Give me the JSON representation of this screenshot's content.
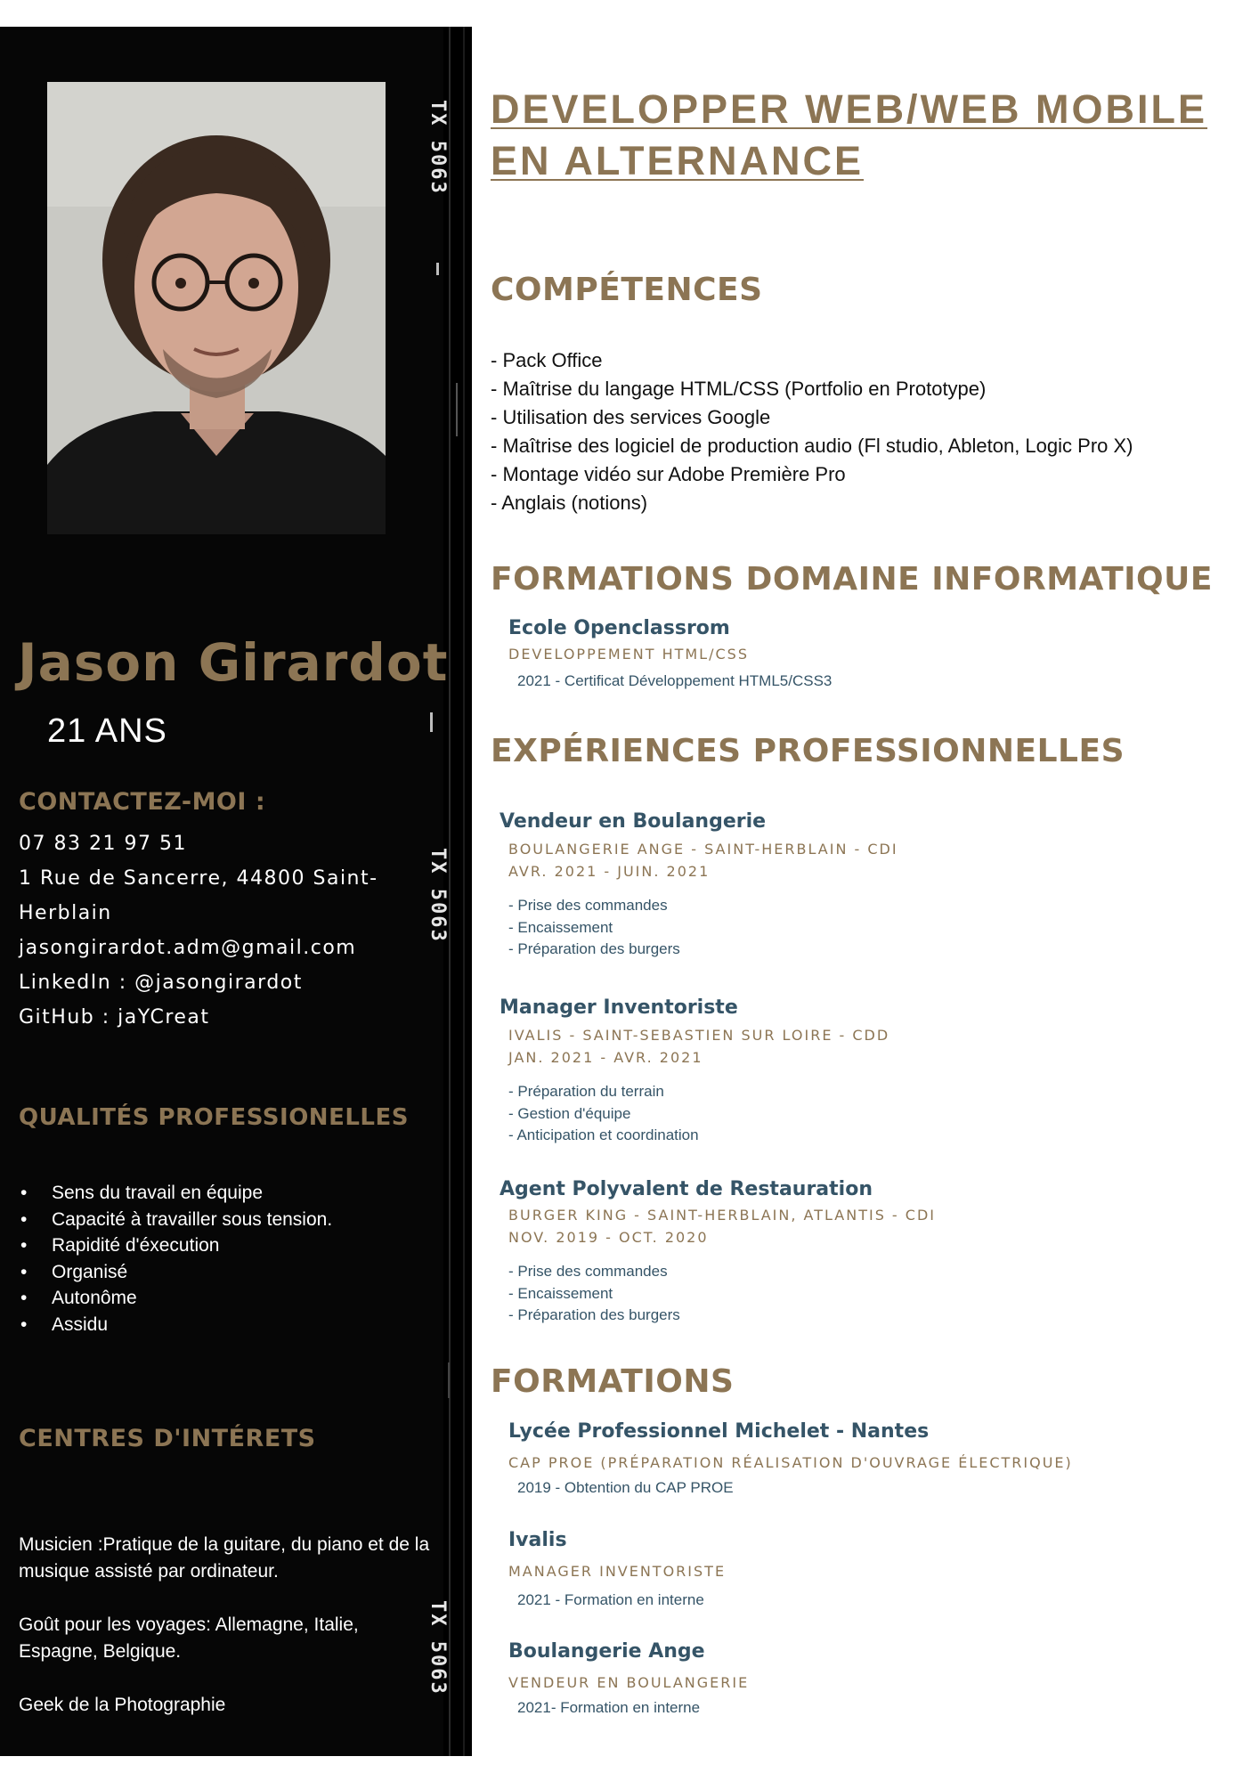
{
  "profile": {
    "name": "Jason Girardot",
    "age": "21 ANS",
    "photo_alt": "portrait-photo",
    "film_marks": [
      "TX 5063",
      "TX 5063",
      "TX 5063"
    ]
  },
  "contact": {
    "heading": "CONTACTEZ-MOI :",
    "phone": "07 83 21 97 51",
    "address_line1": "1 Rue de Sancerre, 44800 Saint-",
    "address_line2": "Herblain",
    "email": "jasongirardot.adm@gmail.com",
    "linkedin": "LinkedIn : @jasongirardot",
    "github": "GitHub : jaYCreat"
  },
  "qualities": {
    "heading": "QUALITÉS PROFESSIONELLES",
    "items": [
      "Sens du travail en équipe",
      "Capacité à travailler sous tension.",
      "Rapidité d'éxecution",
      "Organisé",
      "Autonôme",
      "Assidu"
    ]
  },
  "interests": {
    "heading": "CENTRES D'INTÉRETS",
    "paragraphs": [
      "Musicien :Pratique de la guitare, du piano et de la musique assisté par ordinateur.",
      "Goût pour les voyages: Allemagne, Italie, Espagne, Belgique.",
      "Geek de la Photographie"
    ]
  },
  "header": {
    "title_line1": "DEVELOPPER WEB/WEB MOBILE",
    "title_line2": "EN ALTERNANCE"
  },
  "skills": {
    "heading": "COMPÉTENCES",
    "items": [
      "- Pack Office",
      "- Maîtrise du langage HTML/CSS (Portfolio en Prototype)",
      "- Utilisation des services Google",
      "- Maîtrise des logiciel de production audio (Fl studio, Ableton, Logic Pro X)",
      "- Montage vidéo sur Adobe Première Pro",
      "- Anglais (notions)"
    ]
  },
  "it_training": {
    "heading": "FORMATIONS DOMAINE INFORMATIQUE",
    "school": "Ecole Openclassrom",
    "program": "DEVELOPPEMENT HTML/CSS",
    "note": "2021 - Certificat Développement HTML5/CSS3"
  },
  "experience": {
    "heading": "EXPÉRIENCES PROFESSIONNELLES",
    "jobs": [
      {
        "title": "Vendeur en Boulangerie",
        "company": "BOULANGERIE ANGE - SAINT-HERBLAIN - CDI",
        "dates": "AVR. 2021 - JUIN. 2021",
        "tasks": [
          "- Prise des commandes",
          "- Encaissement",
          "- Préparation des burgers"
        ]
      },
      {
        "title": "Manager Inventoriste",
        "company": "IVALIS - SAINT-SEBASTIEN SUR LOIRE - CDD",
        "dates": "JAN. 2021 - AVR. 2021",
        "tasks": [
          "- Préparation du terrain",
          "- Gestion d'équipe",
          "- Anticipation et coordination"
        ]
      },
      {
        "title": "Agent Polyvalent de Restauration",
        "company": "BURGER KING - SAINT-HERBLAIN, ATLANTIS - CDI",
        "dates": "NOV. 2019 - OCT. 2020",
        "tasks": [
          "- Prise des commandes",
          "- Encaissement",
          "- Préparation des burgers"
        ]
      }
    ]
  },
  "education": {
    "heading": "FORMATIONS",
    "items": [
      {
        "school": "Lycée Professionnel Michelet - Nantes",
        "program": "CAP PROE (PRÉPARATION RÉALISATION D'OUVRAGE ÉLECTRIQUE)",
        "note": "2019 - Obtention du CAP PROE"
      },
      {
        "school": "Ivalis",
        "program": "MANAGER INVENTORISTE",
        "note": "2021 - Formation en interne"
      },
      {
        "school": "Boulangerie Ange",
        "program": "VENDEUR EN BOULANGERIE",
        "note": "2021- Formation en interne"
      }
    ]
  },
  "colors": {
    "accent_gold": "#8c7554",
    "title_blue": "#355467",
    "sidebar_bg": "#060606",
    "text_dark": "#111111"
  }
}
